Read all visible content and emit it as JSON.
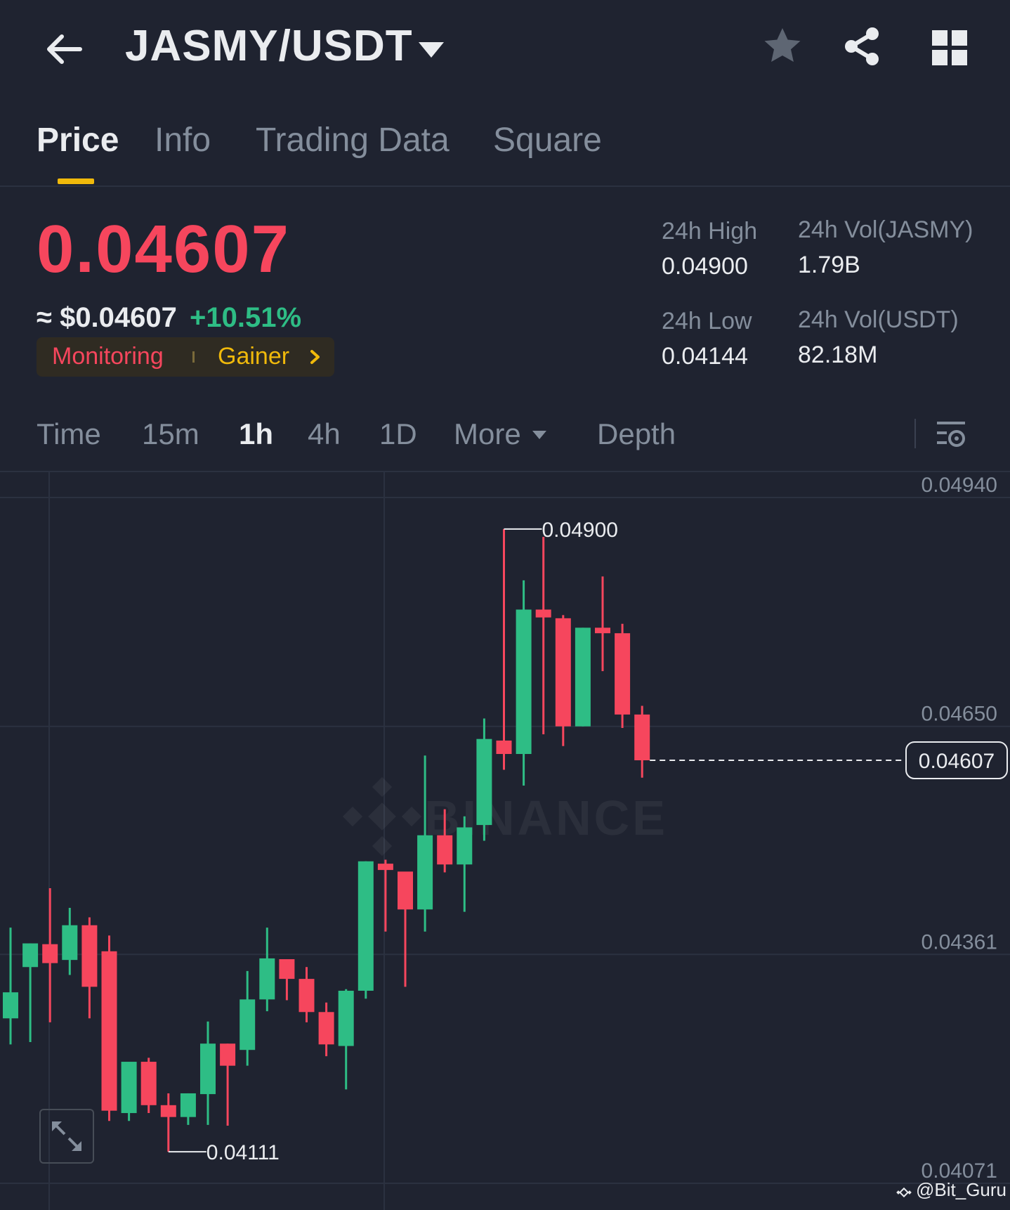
{
  "header": {
    "pair": "JASMY/USDT",
    "icons": [
      "back-arrow-icon",
      "caret-down-icon",
      "star-icon",
      "share-icon",
      "grid-icon"
    ]
  },
  "tabs": [
    {
      "label": "Price",
      "active": true
    },
    {
      "label": "Info",
      "active": false
    },
    {
      "label": "Trading Data",
      "active": false
    },
    {
      "label": "Square",
      "active": false
    }
  ],
  "ticker": {
    "last_price": "0.04607",
    "usd_price": "≈ $0.04607",
    "change": "+10.51%",
    "tags": {
      "monitoring": "Monitoring",
      "gainer": "Gainer"
    },
    "stats": {
      "high_label": "24h High",
      "high_value": "0.04900",
      "low_label": "24h Low",
      "low_value": "0.04144",
      "vol_base_label": "24h Vol(JASMY)",
      "vol_base_value": "1.79B",
      "vol_quote_label": "24h Vol(USDT)",
      "vol_quote_value": "82.18M"
    }
  },
  "intervals": [
    {
      "label": "Time",
      "active": false
    },
    {
      "label": "15m",
      "active": false
    },
    {
      "label": "1h",
      "active": true
    },
    {
      "label": "4h",
      "active": false
    },
    {
      "label": "1D",
      "active": false
    },
    {
      "label": "More",
      "active": false
    },
    {
      "label": "Depth",
      "active": false
    }
  ],
  "watermark": "BINANCE",
  "credit": "@Bit_Guru",
  "colors": {
    "background": "#1f2330",
    "up": "#2ebd85",
    "down": "#f6465d",
    "accent": "#f0b90b",
    "muted": "#848e9c"
  },
  "chart_data": {
    "type": "candlestick",
    "interval": "1h",
    "y_ticks": [
      "0.04940",
      "0.04650",
      "0.04361",
      "0.04071"
    ],
    "ylim": [
      0.0405,
      0.0499
    ],
    "current_price": "0.04607",
    "high_marker": {
      "label": "0.04900",
      "value": 0.049,
      "candle_index": 25
    },
    "low_marker": {
      "label": "0.04111",
      "value": 0.04111,
      "candle_index": 8
    },
    "candles": [
      {
        "o": 0.0428,
        "h": 0.04395,
        "l": 0.04247,
        "c": 0.04313
      },
      {
        "o": 0.04345,
        "h": 0.04375,
        "l": 0.0425,
        "c": 0.04375
      },
      {
        "o": 0.04374,
        "h": 0.04445,
        "l": 0.04275,
        "c": 0.0435
      },
      {
        "o": 0.04354,
        "h": 0.0442,
        "l": 0.04335,
        "c": 0.04398
      },
      {
        "o": 0.04398,
        "h": 0.04408,
        "l": 0.0428,
        "c": 0.0432
      },
      {
        "o": 0.04365,
        "h": 0.04385,
        "l": 0.0415,
        "c": 0.04163
      },
      {
        "o": 0.0416,
        "h": 0.0422,
        "l": 0.0415,
        "c": 0.04225
      },
      {
        "o": 0.04225,
        "h": 0.0423,
        "l": 0.0416,
        "c": 0.0417
      },
      {
        "o": 0.0417,
        "h": 0.04185,
        "l": 0.04111,
        "c": 0.04155
      },
      {
        "o": 0.04155,
        "h": 0.04185,
        "l": 0.04145,
        "c": 0.04185
      },
      {
        "o": 0.04184,
        "h": 0.04276,
        "l": 0.04145,
        "c": 0.04248
      },
      {
        "o": 0.04248,
        "h": 0.04248,
        "l": 0.04144,
        "c": 0.0422
      },
      {
        "o": 0.0424,
        "h": 0.0434,
        "l": 0.0422,
        "c": 0.04304
      },
      {
        "o": 0.04304,
        "h": 0.04395,
        "l": 0.04289,
        "c": 0.04356
      },
      {
        "o": 0.04355,
        "h": 0.04345,
        "l": 0.04303,
        "c": 0.0433
      },
      {
        "o": 0.0433,
        "h": 0.04345,
        "l": 0.04275,
        "c": 0.04288
      },
      {
        "o": 0.04288,
        "h": 0.043,
        "l": 0.04232,
        "c": 0.04247
      },
      {
        "o": 0.04245,
        "h": 0.04317,
        "l": 0.0419,
        "c": 0.04315
      },
      {
        "o": 0.04315,
        "h": 0.04479,
        "l": 0.04305,
        "c": 0.04479
      },
      {
        "o": 0.04476,
        "h": 0.04481,
        "l": 0.0439,
        "c": 0.04468
      },
      {
        "o": 0.04466,
        "h": 0.04444,
        "l": 0.0432,
        "c": 0.04418
      },
      {
        "o": 0.04418,
        "h": 0.04613,
        "l": 0.0439,
        "c": 0.04512
      },
      {
        "o": 0.04512,
        "h": 0.04545,
        "l": 0.04465,
        "c": 0.04475
      },
      {
        "o": 0.04475,
        "h": 0.04536,
        "l": 0.04415,
        "c": 0.04522
      },
      {
        "o": 0.04525,
        "h": 0.0466,
        "l": 0.04505,
        "c": 0.04634
      },
      {
        "o": 0.04632,
        "h": 0.049,
        "l": 0.04595,
        "c": 0.04615
      },
      {
        "o": 0.04615,
        "h": 0.04835,
        "l": 0.04575,
        "c": 0.04798
      },
      {
        "o": 0.04798,
        "h": 0.0489,
        "l": 0.0464,
        "c": 0.04788
      },
      {
        "o": 0.04787,
        "h": 0.04791,
        "l": 0.04625,
        "c": 0.0465
      },
      {
        "o": 0.0465,
        "h": 0.04775,
        "l": 0.0465,
        "c": 0.04775
      },
      {
        "o": 0.04775,
        "h": 0.0484,
        "l": 0.0472,
        "c": 0.04768
      },
      {
        "o": 0.04768,
        "h": 0.0478,
        "l": 0.04648,
        "c": 0.04665
      },
      {
        "o": 0.04665,
        "h": 0.04676,
        "l": 0.04585,
        "c": 0.04607
      }
    ]
  }
}
